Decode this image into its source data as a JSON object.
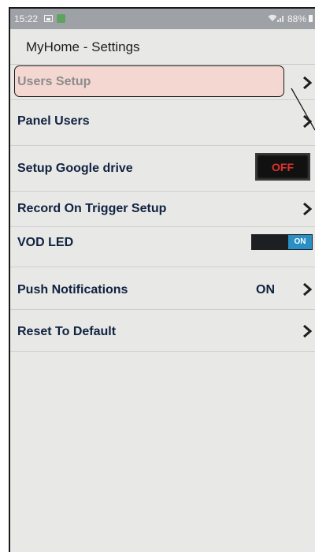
{
  "status_bar": {
    "time": "15:22",
    "battery": "88%"
  },
  "app_bar": {
    "title": "MyHome - Settings"
  },
  "settings": {
    "users_setup": "Users Setup",
    "panel_users": "Panel Users",
    "setup_google_drive": "Setup Google drive",
    "google_drive_toggle": "OFF",
    "record_on_trigger_setup": "Record On Trigger Setup",
    "vod_led": "VOD LED",
    "vod_led_toggle": "ON",
    "push_notifications": "Push Notifications",
    "push_notifications_value": "ON",
    "reset_to_default": "Reset To Default"
  },
  "colors": {
    "highlight": "#f5d7d1",
    "toggle_off_text": "#e0342a",
    "toggle_on_knob": "#2a8fc4",
    "label_text": "#0f2240"
  }
}
